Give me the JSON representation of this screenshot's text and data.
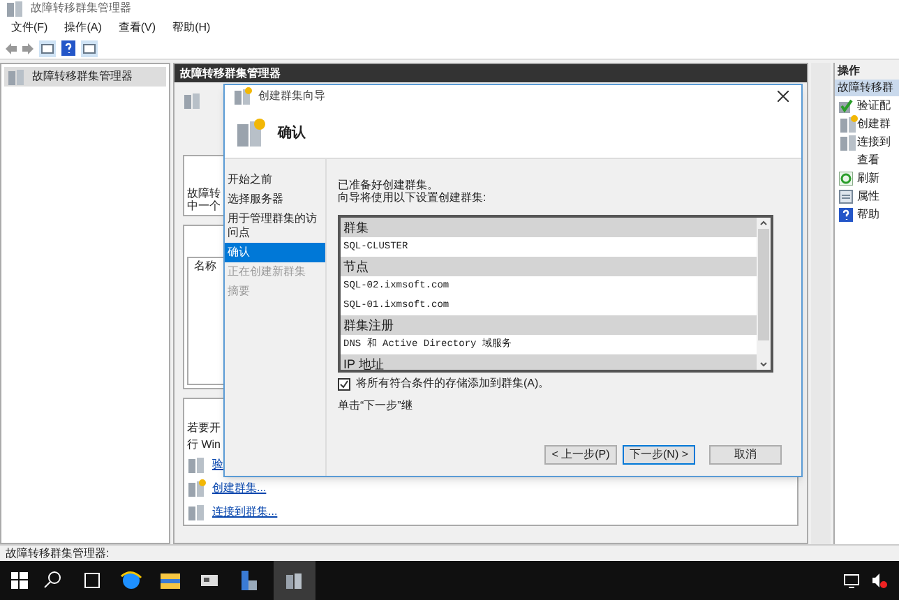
{
  "window": {
    "title": "故障转移群集管理器"
  },
  "menu": [
    "文件(F)",
    "操作(A)",
    "查看(V)",
    "帮助(H)"
  ],
  "tree": [
    {
      "label": "故障转移群集管理器",
      "selected": true
    }
  ],
  "center": {
    "header": "故障转移群集管理器",
    "texts": [
      "故障转",
      "中一个",
      "名称",
      "若要开",
      "行 Win"
    ],
    "links": [
      "验",
      "创建群集...",
      "连接到群集..."
    ]
  },
  "actions": {
    "title": "操作",
    "group": "故障转移群",
    "items": [
      {
        "label": "验证配",
        "kind": "check"
      },
      {
        "label": "创建群",
        "kind": "create"
      },
      {
        "label": "连接到",
        "kind": "connect"
      },
      {
        "label": "查看",
        "kind": "plain"
      },
      {
        "label": "刷新",
        "kind": "refresh"
      },
      {
        "label": "属性",
        "kind": "props"
      },
      {
        "label": "帮助",
        "kind": "help"
      }
    ]
  },
  "dialog": {
    "title": "创建群集向导",
    "heading": "确认",
    "steps": [
      {
        "label": "开始之前",
        "selected": false,
        "disabled": false
      },
      {
        "label": "选择服务器",
        "selected": false,
        "disabled": false
      },
      {
        "label": "用于管理群集的访问点",
        "selected": false,
        "disabled": false
      },
      {
        "label": "确认",
        "selected": true,
        "disabled": false
      },
      {
        "label": "正在创建新群集",
        "selected": false,
        "disabled": true
      },
      {
        "label": "摘要",
        "selected": false,
        "disabled": true
      }
    ],
    "intro": [
      "已准备好创建群集。",
      "向导将使用以下设置创建群集:"
    ],
    "rows": [
      {
        "kind": "header",
        "text": "群集"
      },
      {
        "kind": "value",
        "text": "SQL-CLUSTER"
      },
      {
        "kind": "header",
        "text": "节点"
      },
      {
        "kind": "value",
        "text": "SQL-02.ixmsoft.com"
      },
      {
        "kind": "value",
        "text": "SQL-01.ixmsoft.com"
      },
      {
        "kind": "header",
        "text": "群集注册"
      },
      {
        "kind": "value",
        "text": "DNS 和 Active Directory 域服务"
      },
      {
        "kind": "header",
        "text": "IP 地址"
      }
    ],
    "checkbox": {
      "label": "将所有符合条件的存储添加到群集(A)。",
      "checked": true
    },
    "hint": "单击“下一步”继",
    "buttons": [
      {
        "label": "< 上一步(P)",
        "selected": false
      },
      {
        "label": "下一步(N) >",
        "selected": true
      },
      {
        "label": "取消",
        "selected": false
      }
    ]
  },
  "status_bar": "故障转移群集管理器:"
}
